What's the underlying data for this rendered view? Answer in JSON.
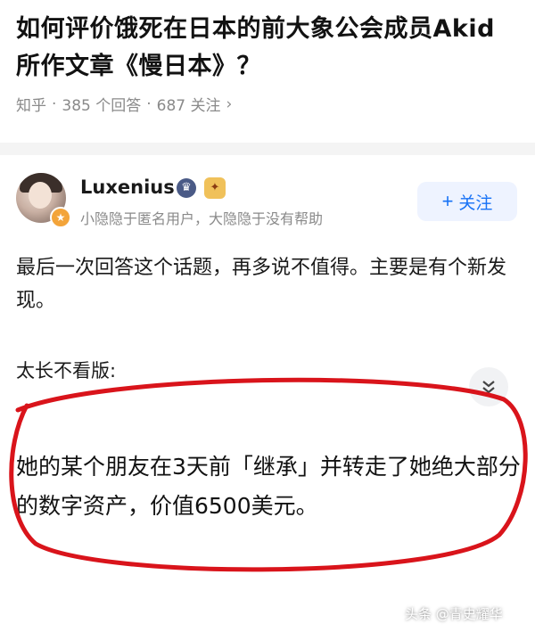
{
  "question": {
    "title": "如何评价饿死在日本的前大象公会成员Akid所作文章《慢日本》？",
    "source": "知乎",
    "answers": "385 个回答",
    "followers": "687 关注",
    "chevron": "›"
  },
  "answer": {
    "author": {
      "name": "Luxenius",
      "bio": "小隐隐于匿名用户，大隐隐于没有帮助",
      "badge_a_icon": "crown-badge-icon",
      "badge_b_icon": "creator-badge-icon"
    },
    "follow_button": {
      "plus": "+",
      "label": "关注"
    },
    "intro": "最后一次回答这个话题，再多说不值得。主要是有个新发现。",
    "tldr_label": "太长不看版:",
    "highlight": "她的某个朋友在3天前「继承」并转走了她绝大部分的数字资产，价值6500美元。"
  },
  "watermark": "头条 @青史耀华",
  "colors": {
    "accent": "#1772f6",
    "highlight_circle": "#d9141b"
  }
}
